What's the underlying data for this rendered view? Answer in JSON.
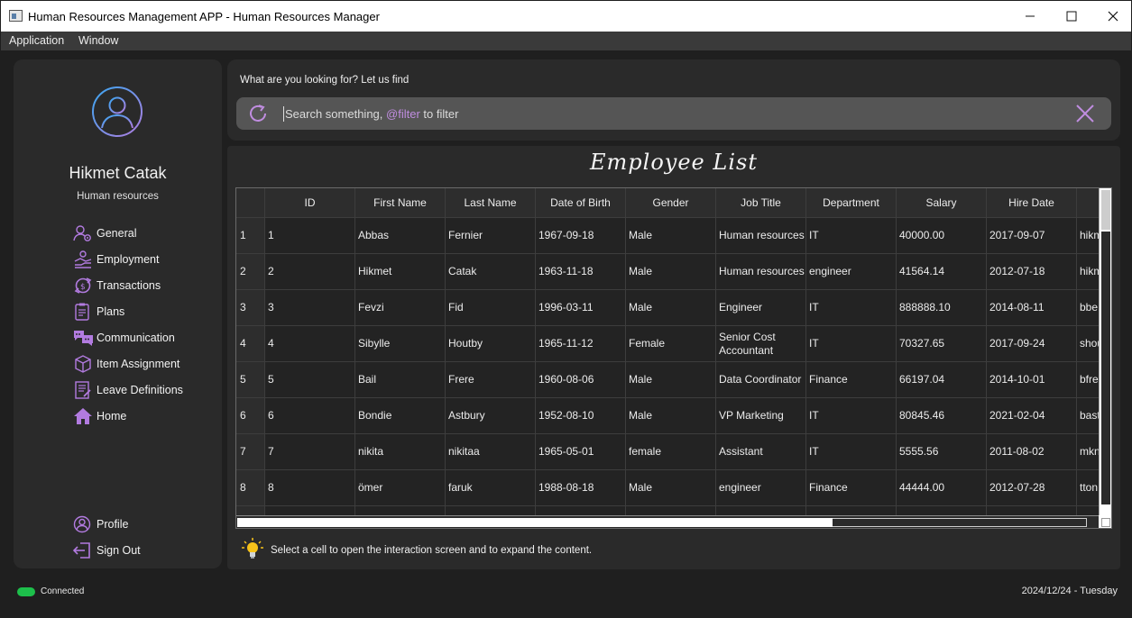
{
  "window": {
    "title": "Human Resources Management APP - Human Resources Manager",
    "minimize_glyph": "—",
    "maximize_glyph": "☐",
    "close_glyph": "✕"
  },
  "menubar": {
    "items": [
      "Application",
      "Window"
    ]
  },
  "sidebar": {
    "user_name": "Hikmet Catak",
    "user_role": "Human resources",
    "nav": [
      {
        "label": "General",
        "icon": "user-gear-icon"
      },
      {
        "label": "Employment",
        "icon": "handshake-icon"
      },
      {
        "label": "Transactions",
        "icon": "exchange-icon"
      },
      {
        "label": "Plans",
        "icon": "clipboard-icon"
      },
      {
        "label": "Communication",
        "icon": "chat-icon"
      },
      {
        "label": "Item Assignment",
        "icon": "box-icon"
      },
      {
        "label": "Leave Definitions",
        "icon": "document-icon"
      },
      {
        "label": "Home",
        "icon": "home-icon"
      }
    ],
    "bottom": [
      {
        "label": "Profile",
        "icon": "profile-icon"
      },
      {
        "label": "Sign Out",
        "icon": "sign-out-icon"
      }
    ],
    "accent_color": "#b27be0"
  },
  "search": {
    "caption": "What are you looking for? Let us find",
    "placeholder_prefix": "Search something, ",
    "placeholder_highlight": "@filter",
    "placeholder_suffix": " to filter"
  },
  "table": {
    "title": "Employee List",
    "columns": [
      "ID",
      "First Name",
      "Last Name",
      "Date of Birth",
      "Gender",
      "Job Title",
      "Department",
      "Salary",
      "Hire Date",
      ""
    ],
    "rows": [
      {
        "num": "1",
        "cells": [
          "1",
          "Abbas",
          "Fernier",
          "1967-09-18",
          "Male",
          "Human resources",
          "IT",
          "40000.00",
          "2017-09-07",
          "hikm"
        ]
      },
      {
        "num": "2",
        "cells": [
          "2",
          "Hikmet",
          "Catak",
          "1963-11-18",
          "Male",
          "Human resources",
          "engineer",
          "41564.14",
          "2012-07-18",
          "hikm"
        ]
      },
      {
        "num": "3",
        "cells": [
          "3",
          "Fevzi",
          "Fid",
          "1996-03-11",
          "Male",
          "Engineer",
          "IT",
          "888888.10",
          "2014-08-11",
          "bbe"
        ]
      },
      {
        "num": "4",
        "cells": [
          "4",
          "Sibylle",
          "Houtby",
          "1965-11-12",
          "Female",
          "Senior Cost Accountant",
          "IT",
          "70327.65",
          "2017-09-24",
          "shou"
        ]
      },
      {
        "num": "5",
        "cells": [
          "5",
          "Bail",
          "Frere",
          "1960-08-06",
          "Male",
          "Data Coordinator",
          "Finance",
          "66197.04",
          "2014-10-01",
          "bfre"
        ]
      },
      {
        "num": "6",
        "cells": [
          "6",
          "Bondie",
          "Astbury",
          "1952-08-10",
          "Male",
          "VP Marketing",
          "IT",
          "80845.46",
          "2021-02-04",
          "bast"
        ]
      },
      {
        "num": "7",
        "cells": [
          "7",
          "nikita",
          "nikitaa",
          "1965-05-01",
          "female",
          "Assistant",
          "IT",
          "5555.56",
          "2011-08-02",
          "mkn"
        ]
      },
      {
        "num": "8",
        "cells": [
          "8",
          "ömer",
          "faruk",
          "1988-08-18",
          "Male",
          "engineer",
          "Finance",
          "44444.00",
          "2012-07-28",
          "tton"
        ]
      }
    ],
    "hint": "Select a cell to open the interaction screen and to expand the content."
  },
  "status": {
    "connection": "Connected",
    "connection_color": "#1dbf4b",
    "date": "2024/12/24 - Tuesday"
  }
}
